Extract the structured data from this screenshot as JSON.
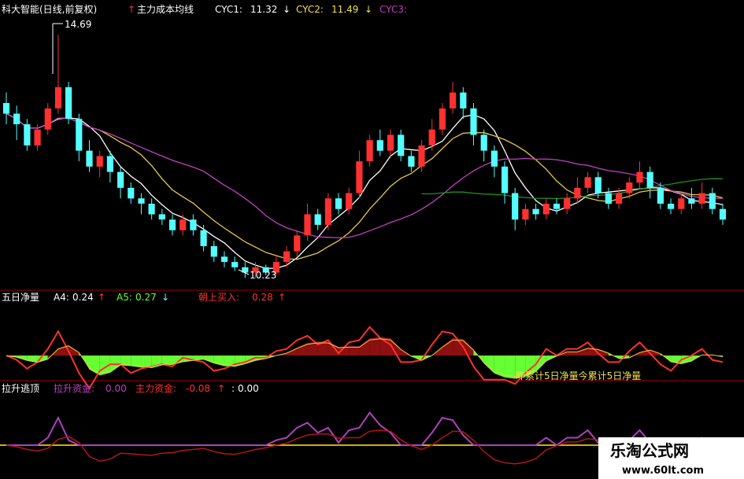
{
  "main": {
    "title": "科大智能(日线,前复权)",
    "indicator_name": "主力成本均线",
    "cyc1_label": "CYC1:",
    "cyc1_value": "11.32",
    "cyc2_label": "CYC2:",
    "cyc2_value": "11.49",
    "cyc3_label": "CYC3:",
    "high_label": "14.69",
    "low_label": "10.23",
    "arrow_down": "↓",
    "arrow_up": "↑"
  },
  "panel2": {
    "title": "五日净量",
    "a4_label": "A4:",
    "a4_value": "0.24",
    "a5_label": "A5:",
    "a5_value": "0.27",
    "buy_label": "朝上买入:",
    "buy_value": "0.28",
    "annotation": "昨累计5日净量今累计5日净量"
  },
  "panel3": {
    "title": "拉升逃顶",
    "lift_label": "拉升资金:",
    "lift_value": "0.00",
    "main_label": "主力资金:",
    "main_value": "-0.08",
    "extra_label": ":",
    "extra_value": "0.00"
  },
  "watermark": {
    "name": "乐淘公式网",
    "url": "www.60lt.com"
  },
  "colors": {
    "background": "#000000",
    "up_candle": "#ff3030",
    "down_candle": "#54ffff",
    "ma_white": "#ffffff",
    "ma_yellow": "#e8c84a",
    "ma_purple": "#c040c0",
    "ma_green": "#1e8c1e",
    "separator": "#a00000",
    "vol_green_fill": "#66ff33",
    "vol_red_fill": "#8b1010",
    "panel3_purple": "#b040c0",
    "panel3_darkred": "#b01818",
    "panel3_yellow": "#d0b000"
  },
  "chart_data": [
    {
      "type": "candlestick",
      "title": "科大智能(日线,前复权)",
      "y_range": [
        10.0,
        14.9
      ],
      "marked_high": 14.69,
      "marked_low": 10.23,
      "series": [
        {
          "name": "CYC1",
          "last_value": 11.32
        },
        {
          "name": "CYC2",
          "last_value": 11.49
        },
        {
          "name": "CYC3"
        }
      ],
      "candles": [
        [
          13.4,
          13.2,
          13.6,
          13.0
        ],
        [
          13.2,
          13.0,
          13.35,
          12.7
        ],
        [
          13.0,
          12.6,
          13.1,
          12.5
        ],
        [
          12.6,
          12.9,
          13.0,
          12.5
        ],
        [
          12.9,
          13.3,
          13.4,
          12.8
        ],
        [
          13.3,
          13.7,
          14.69,
          13.2
        ],
        [
          13.7,
          13.1,
          13.8,
          13.0
        ],
        [
          13.1,
          12.5,
          13.2,
          12.3
        ],
        [
          12.5,
          12.2,
          12.7,
          12.1
        ],
        [
          12.2,
          12.4,
          12.5,
          12.0
        ],
        [
          12.4,
          12.1,
          12.5,
          11.9
        ],
        [
          12.1,
          11.8,
          12.2,
          11.6
        ],
        [
          11.8,
          11.6,
          11.9,
          11.5
        ],
        [
          11.6,
          11.5,
          11.7,
          11.3
        ],
        [
          11.5,
          11.3,
          11.6,
          11.2
        ],
        [
          11.3,
          11.2,
          11.4,
          11.1
        ],
        [
          11.2,
          11.0,
          11.3,
          10.9
        ],
        [
          11.0,
          11.2,
          11.3,
          10.9
        ],
        [
          11.2,
          11.0,
          11.3,
          10.9
        ],
        [
          11.0,
          10.7,
          11.1,
          10.6
        ],
        [
          10.7,
          10.5,
          10.8,
          10.4
        ],
        [
          10.5,
          10.4,
          10.6,
          10.3
        ],
        [
          10.4,
          10.3,
          10.5,
          10.23
        ],
        [
          10.3,
          10.2,
          10.4,
          10.1
        ],
        [
          10.2,
          10.3,
          10.4,
          10.1
        ],
        [
          10.3,
          10.2,
          10.35,
          10.15
        ],
        [
          10.2,
          10.4,
          10.5,
          10.15
        ],
        [
          10.4,
          10.6,
          10.7,
          10.3
        ],
        [
          10.6,
          10.9,
          11.0,
          10.5
        ],
        [
          10.9,
          11.3,
          11.5,
          10.8
        ],
        [
          11.3,
          11.1,
          11.4,
          11.0
        ],
        [
          11.1,
          11.6,
          11.7,
          11.0
        ],
        [
          11.6,
          11.4,
          11.7,
          11.3
        ],
        [
          11.4,
          11.7,
          11.8,
          11.3
        ],
        [
          11.7,
          12.3,
          12.5,
          11.6
        ],
        [
          12.3,
          12.7,
          12.8,
          12.2
        ],
        [
          12.7,
          12.5,
          12.9,
          12.4
        ],
        [
          12.5,
          12.8,
          12.9,
          12.4
        ],
        [
          12.8,
          12.4,
          12.9,
          12.3
        ],
        [
          12.4,
          12.2,
          12.5,
          12.1
        ],
        [
          12.2,
          12.6,
          12.7,
          12.1
        ],
        [
          12.6,
          12.9,
          13.1,
          12.5
        ],
        [
          12.9,
          13.3,
          13.4,
          12.8
        ],
        [
          13.3,
          13.6,
          13.8,
          13.2
        ],
        [
          13.6,
          13.3,
          13.7,
          13.1
        ],
        [
          13.3,
          12.8,
          13.4,
          12.6
        ],
        [
          12.8,
          12.5,
          12.9,
          12.3
        ],
        [
          12.5,
          12.2,
          12.6,
          12.0
        ],
        [
          12.2,
          11.7,
          12.3,
          11.5
        ],
        [
          11.7,
          11.2,
          11.8,
          11.0
        ],
        [
          11.2,
          11.4,
          11.5,
          11.1
        ],
        [
          11.4,
          11.3,
          11.5,
          11.2
        ],
        [
          11.3,
          11.5,
          11.6,
          11.2
        ],
        [
          11.5,
          11.4,
          11.6,
          11.3
        ],
        [
          11.4,
          11.6,
          11.7,
          11.3
        ],
        [
          11.6,
          11.8,
          12.0,
          11.5
        ],
        [
          11.8,
          12.0,
          12.1,
          11.7
        ],
        [
          12.0,
          11.7,
          12.1,
          11.6
        ],
        [
          11.7,
          11.5,
          11.8,
          11.4
        ],
        [
          11.5,
          11.7,
          11.8,
          11.4
        ],
        [
          11.7,
          11.9,
          12.0,
          11.6
        ],
        [
          11.9,
          12.1,
          12.3,
          11.8
        ],
        [
          12.1,
          11.8,
          12.2,
          11.6
        ],
        [
          11.8,
          11.5,
          11.9,
          11.4
        ],
        [
          11.5,
          11.4,
          11.6,
          11.3
        ],
        [
          11.4,
          11.6,
          11.7,
          11.3
        ],
        [
          11.6,
          11.5,
          11.8,
          11.4
        ],
        [
          11.5,
          11.7,
          11.9,
          11.4
        ],
        [
          11.7,
          11.4,
          11.8,
          11.3
        ],
        [
          11.4,
          11.2,
          11.5,
          11.1
        ]
      ]
    },
    {
      "type": "area",
      "title": "五日净量",
      "series": [
        {
          "name": "A4",
          "last_value": 0.24
        },
        {
          "name": "A5",
          "last_value": 0.27
        },
        {
          "name": "朝上买入",
          "last_value": 0.28
        }
      ]
    },
    {
      "type": "line",
      "title": "拉升逃顶",
      "series": [
        {
          "name": "拉升资金",
          "last_value": 0.0
        },
        {
          "name": "主力资金",
          "last_value": -0.08
        }
      ]
    }
  ]
}
